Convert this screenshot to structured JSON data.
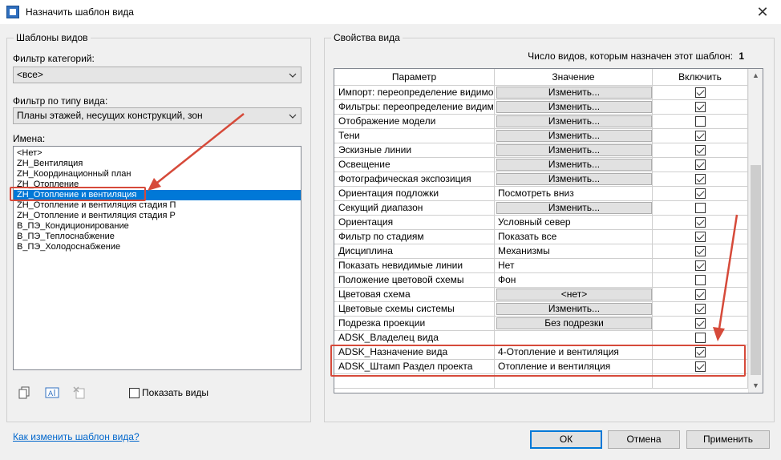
{
  "window": {
    "title": "Назначить шаблон вида",
    "close_glyph": "✕"
  },
  "left": {
    "group_label": "Шаблоны видов",
    "category_filter_label": "Фильтр категорий:",
    "category_filter_value": "<все>",
    "viewtype_filter_label": "Фильтр по типу вида:",
    "viewtype_filter_value": "Планы этажей, несущих конструкций, зон",
    "names_label": "Имена:",
    "names": [
      "<Нет>",
      "ZH_Вентиляция",
      "ZH_Координационный план",
      "ZH_Отопление",
      "ZH_Отопление и вентиляция",
      "ZH_Отопление и вентиляция стадия П",
      "ZH_Отопление и вентиляция стадия Р",
      "В_ПЭ_Кондиционирование",
      "В_ПЭ_Теплоснабжение",
      "В_ПЭ_Холодоснабжение"
    ],
    "selected_index": 4,
    "show_views_label": "Показать виды"
  },
  "right": {
    "group_label": "Свойства вида",
    "count_label": "Число видов, которым назначен этот шаблон:",
    "count_value": "1",
    "columns": [
      "Параметр",
      "Значение",
      "Включить"
    ],
    "rows": [
      {
        "param": "Импорт: переопределение видимо",
        "value": "Изменить...",
        "button": true,
        "checked": true
      },
      {
        "param": "Фильтры: переопределение видим",
        "value": "Изменить...",
        "button": true,
        "checked": true
      },
      {
        "param": "Отображение модели",
        "value": "Изменить...",
        "button": true,
        "checked": false
      },
      {
        "param": "Тени",
        "value": "Изменить...",
        "button": true,
        "checked": true
      },
      {
        "param": "Эскизные линии",
        "value": "Изменить...",
        "button": true,
        "checked": true
      },
      {
        "param": "Освещение",
        "value": "Изменить...",
        "button": true,
        "checked": true
      },
      {
        "param": "Фотографическая экспозиция",
        "value": "Изменить...",
        "button": true,
        "checked": true
      },
      {
        "param": "Ориентация подложки",
        "value": "Посмотреть вниз",
        "button": false,
        "checked": true
      },
      {
        "param": "Секущий диапазон",
        "value": "Изменить...",
        "button": true,
        "checked": false
      },
      {
        "param": "Ориентация",
        "value": "Условный север",
        "button": false,
        "checked": true
      },
      {
        "param": "Фильтр по стадиям",
        "value": "Показать все",
        "button": false,
        "checked": true
      },
      {
        "param": "Дисциплина",
        "value": "Механизмы",
        "button": false,
        "checked": true
      },
      {
        "param": "Показать невидимые линии",
        "value": "Нет",
        "button": false,
        "checked": true
      },
      {
        "param": "Положение цветовой схемы",
        "value": "Фон",
        "button": false,
        "checked": false
      },
      {
        "param": "Цветовая схема",
        "value": "<нет>",
        "button": true,
        "checked": true
      },
      {
        "param": "Цветовые схемы системы",
        "value": "Изменить...",
        "button": true,
        "checked": true
      },
      {
        "param": "Подрезка проекции",
        "value": "Без подрезки",
        "button": true,
        "checked": true
      },
      {
        "param": "ADSK_Владелец вида",
        "value": "",
        "button": false,
        "checked": false
      },
      {
        "param": "ADSK_Назначение вида",
        "value": "4-Отопление и вентиляция",
        "button": false,
        "checked": true
      },
      {
        "param": "ADSK_Штамп Раздел проекта",
        "value": "Отопление и вентиляция",
        "button": false,
        "checked": true
      }
    ]
  },
  "footer": {
    "help_link": "Как изменить шаблон вида?",
    "ok_label": "ОК",
    "cancel_label": "Отмена",
    "apply_label": "Применить"
  },
  "colors": {
    "accent": "#0078d7",
    "annotation": "#d64a3a"
  }
}
